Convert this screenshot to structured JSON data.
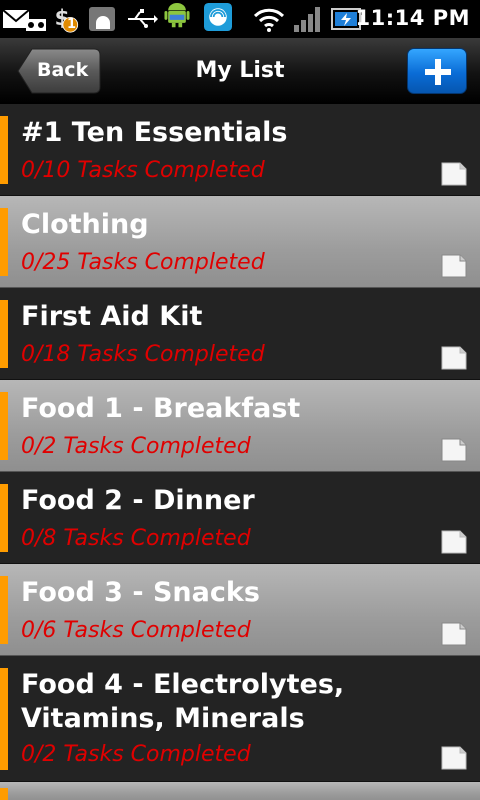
{
  "status_bar": {
    "time": "11:14 PM",
    "notification_badge": "1",
    "icons": [
      "mail-icon",
      "voicemail-icon",
      "money-icon",
      "android-icon",
      "usb-icon",
      "android-robot-icon",
      "wireless-app-icon",
      "wifi-icon",
      "signal-icon",
      "battery-icon"
    ]
  },
  "header": {
    "back_label": "Back",
    "title": "My List",
    "add_icon": "plus-icon"
  },
  "colors": {
    "accent": "#ff9c00",
    "subtitle": "#e00000",
    "add_button": "#0a6cd6"
  },
  "list": {
    "items": [
      {
        "title": "#1 Ten Essentials",
        "subtitle": "0/10 Tasks Completed"
      },
      {
        "title": "Clothing",
        "subtitle": "0/25 Tasks Completed"
      },
      {
        "title": "First Aid Kit",
        "subtitle": "0/18 Tasks Completed"
      },
      {
        "title": "Food 1 - Breakfast",
        "subtitle": "0/2 Tasks Completed"
      },
      {
        "title": "Food 2 - Dinner",
        "subtitle": "0/8 Tasks Completed"
      },
      {
        "title": "Food 3 - Snacks",
        "subtitle": "0/6 Tasks Completed"
      },
      {
        "title": "Food 4 - Electrolytes, Vitamins, Minerals",
        "subtitle": "0/2 Tasks Completed"
      }
    ]
  }
}
